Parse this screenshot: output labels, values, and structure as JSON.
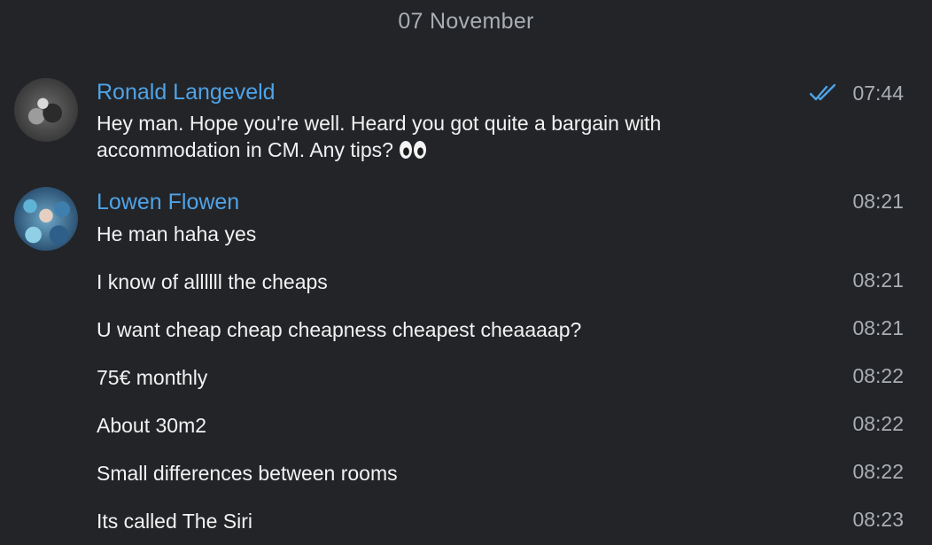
{
  "date_separator": "07 November",
  "messages": [
    {
      "sender": "Ronald Langeveld",
      "text": "Hey man. Hope you're well. Heard you got quite a bargain with\naccommodation in CM. Any tips?",
      "emoji": "eyes-emoji",
      "time": "07:44",
      "read_status": "double-check-icon"
    },
    {
      "sender": "Lowen Flowen",
      "text": "He man haha yes",
      "time": "08:21"
    },
    {
      "text": "I know of allllll the cheaps",
      "time": "08:21"
    },
    {
      "text": "U want cheap cheap cheapness cheapest cheaaaap?",
      "time": "08:21"
    },
    {
      "text": "75€ monthly",
      "time": "08:22"
    },
    {
      "text": "About 30m2",
      "time": "08:22"
    },
    {
      "text": "Small differences between rooms",
      "time": "08:22"
    },
    {
      "text": "Its called The Siri",
      "time": "08:23"
    }
  ],
  "colors": {
    "background": "#232428",
    "sender_name": "#4fa3e6",
    "meta_text": "#a9adb4",
    "message_text": "#f2f2f2"
  }
}
